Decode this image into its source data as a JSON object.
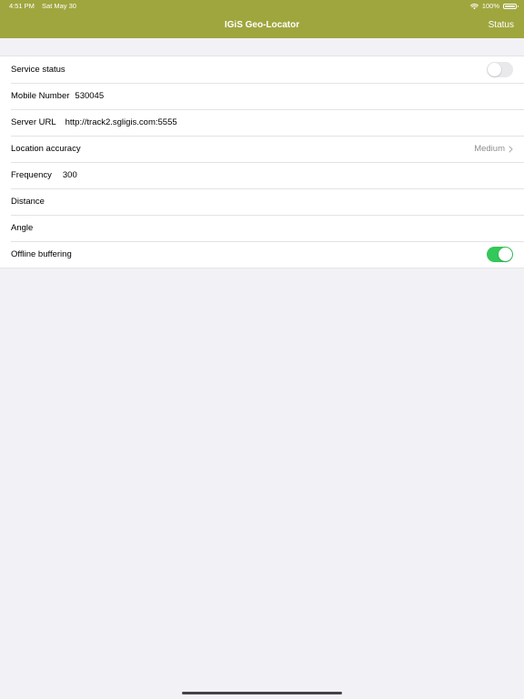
{
  "status_bar": {
    "time": "4:51 PM",
    "date": "Sat May 30",
    "battery": "100%"
  },
  "nav": {
    "title": "IGiS Geo-Locator",
    "right_button": "Status",
    "color": "#9fa63e"
  },
  "settings": {
    "service_status": {
      "label": "Service status",
      "enabled": false
    },
    "mobile_number": {
      "label": "Mobile Number",
      "value": "530045"
    },
    "server_url": {
      "label": "Server URL",
      "value": "http://track2.sgligis.com:5555"
    },
    "location_accuracy": {
      "label": "Location accuracy",
      "value": "Medium"
    },
    "frequency": {
      "label": "Frequency",
      "value": "300"
    },
    "distance": {
      "label": "Distance",
      "value": ""
    },
    "angle": {
      "label": "Angle",
      "value": ""
    },
    "offline_buffering": {
      "label": "Offline buffering",
      "enabled": true
    }
  },
  "colors": {
    "toggle_on": "#34c759",
    "toggle_off": "#e9e9eb",
    "background": "#f2f1f6"
  }
}
